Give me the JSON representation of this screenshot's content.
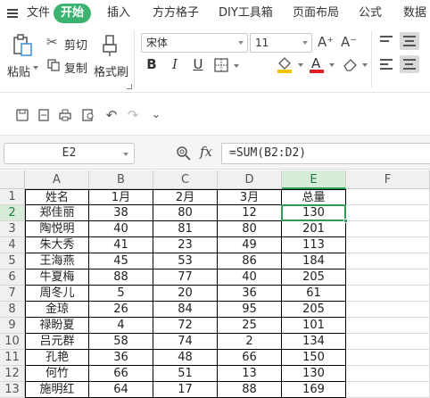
{
  "menu": {
    "file": "文件",
    "tabs": [
      "开始",
      "插入",
      "方方格子",
      "DIY工具箱",
      "页面布局",
      "公式",
      "数据"
    ]
  },
  "ribbon": {
    "paste": "粘贴",
    "cut": "剪切",
    "copy": "复制",
    "format_painter": "格式刷",
    "font_name": "宋体",
    "font_size": "11",
    "grow_font": "A⁺",
    "shrink_font": "A⁻",
    "bold": "B",
    "italic": "I",
    "underline": "U",
    "font_color_letter": "A"
  },
  "formula_bar": {
    "cell_ref": "E2",
    "fx": "fx",
    "formula": "=SUM(B2:D2)"
  },
  "sheet": {
    "columns": [
      "A",
      "B",
      "C",
      "D",
      "E",
      "F"
    ],
    "rows": [
      {
        "num": "1",
        "a": "姓名",
        "b": "1月",
        "c": "2月",
        "d": "3月",
        "e": "总量"
      },
      {
        "num": "2",
        "a": "郑佳丽",
        "b": "38",
        "c": "80",
        "d": "12",
        "e": "130"
      },
      {
        "num": "3",
        "a": "陶悦明",
        "b": "40",
        "c": "81",
        "d": "80",
        "e": "201"
      },
      {
        "num": "4",
        "a": "朱大秀",
        "b": "41",
        "c": "23",
        "d": "49",
        "e": "113"
      },
      {
        "num": "5",
        "a": "王海燕",
        "b": "45",
        "c": "53",
        "d": "86",
        "e": "184"
      },
      {
        "num": "6",
        "a": "牛夏梅",
        "b": "88",
        "c": "77",
        "d": "40",
        "e": "205"
      },
      {
        "num": "7",
        "a": "周冬儿",
        "b": "5",
        "c": "20",
        "d": "36",
        "e": "61"
      },
      {
        "num": "8",
        "a": "金琼",
        "b": "26",
        "c": "84",
        "d": "95",
        "e": "205"
      },
      {
        "num": "9",
        "a": "禄盼夏",
        "b": "4",
        "c": "72",
        "d": "25",
        "e": "101"
      },
      {
        "num": "10",
        "a": "吕元群",
        "b": "58",
        "c": "74",
        "d": "2",
        "e": "134"
      },
      {
        "num": "11",
        "a": "孔艳",
        "b": "36",
        "c": "48",
        "d": "66",
        "e": "150"
      },
      {
        "num": "12",
        "a": "何竹",
        "b": "66",
        "c": "51",
        "d": "13",
        "e": "130"
      },
      {
        "num": "13",
        "a": "施明红",
        "b": "64",
        "c": "17",
        "d": "88",
        "e": "169"
      }
    ],
    "selected_cell": "E2",
    "accent_color": "#2f9c55"
  }
}
